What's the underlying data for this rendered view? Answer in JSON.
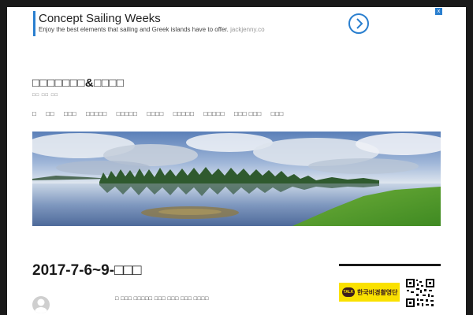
{
  "ad": {
    "title": "Concept Sailing Weeks",
    "description": "Enjoy the best elements that sailing and Greek islands have to offer.",
    "domain": "jackjenny.co",
    "close_label": "x",
    "accent_color": "#2a7fcf"
  },
  "site": {
    "title": "□□□□□□□&□□□□",
    "description": "□□ □□ □□"
  },
  "nav": {
    "items": [
      "□",
      "□□",
      "□□□",
      "□□□□□",
      "□□□□□",
      "□□□□",
      "□□□□□",
      "□□□□□",
      "□□□ □□□",
      "□□□"
    ]
  },
  "hero": {
    "alt": "lake landscape banner"
  },
  "post": {
    "title": "2017-7-6~9-□□□",
    "meta": "□ □□□ □□□□□ □□□ □□□ □□□ □□□□"
  },
  "sidebar": {
    "kakao_badge": "TALK",
    "kakao_label": "한국비경촬영단",
    "kakao_color": "#fae100"
  },
  "icons": {
    "ad_arrow": "chevron-right-icon",
    "avatar": "user-avatar-icon",
    "qr": "qr-code-icon"
  }
}
